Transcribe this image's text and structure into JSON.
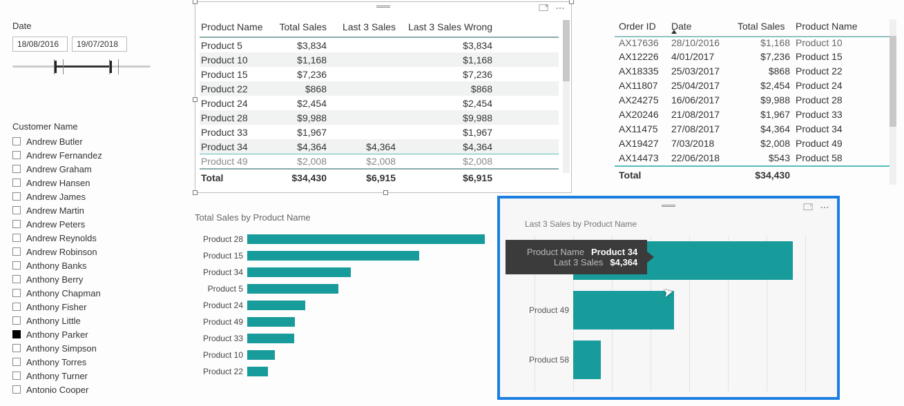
{
  "date_slicer": {
    "title": "Date",
    "start": "18/08/2016",
    "end": "19/07/2018"
  },
  "customer_slicer": {
    "title": "Customer Name",
    "items": [
      {
        "name": "Andrew Butler",
        "selected": false
      },
      {
        "name": "Andrew Fernandez",
        "selected": false
      },
      {
        "name": "Andrew Graham",
        "selected": false
      },
      {
        "name": "Andrew Hansen",
        "selected": false
      },
      {
        "name": "Andrew James",
        "selected": false
      },
      {
        "name": "Andrew Martin",
        "selected": false
      },
      {
        "name": "Andrew Peters",
        "selected": false
      },
      {
        "name": "Andrew Reynolds",
        "selected": false
      },
      {
        "name": "Andrew Robinson",
        "selected": false
      },
      {
        "name": "Anthony Banks",
        "selected": false
      },
      {
        "name": "Anthony Berry",
        "selected": false
      },
      {
        "name": "Anthony Chapman",
        "selected": false
      },
      {
        "name": "Anthony Fisher",
        "selected": false
      },
      {
        "name": "Anthony Little",
        "selected": false
      },
      {
        "name": "Anthony Parker",
        "selected": true
      },
      {
        "name": "Anthony Simpson",
        "selected": false
      },
      {
        "name": "Anthony Torres",
        "selected": false
      },
      {
        "name": "Anthony Turner",
        "selected": false
      },
      {
        "name": "Antonio Cooper",
        "selected": false
      }
    ]
  },
  "sales_table": {
    "headers": [
      "Product Name",
      "Total Sales",
      "Last 3 Sales",
      "Last 3 Sales Wrong"
    ],
    "rows": [
      {
        "product": "Product 5",
        "total": "$3,834",
        "last3": "",
        "last3wrong": "$3,834"
      },
      {
        "product": "Product 10",
        "total": "$1,168",
        "last3": "",
        "last3wrong": "$1,168"
      },
      {
        "product": "Product 15",
        "total": "$7,236",
        "last3": "",
        "last3wrong": "$7,236"
      },
      {
        "product": "Product 22",
        "total": "$868",
        "last3": "",
        "last3wrong": "$868"
      },
      {
        "product": "Product 24",
        "total": "$2,454",
        "last3": "",
        "last3wrong": "$2,454"
      },
      {
        "product": "Product 28",
        "total": "$9,988",
        "last3": "",
        "last3wrong": "$9,988"
      },
      {
        "product": "Product 33",
        "total": "$1,967",
        "last3": "",
        "last3wrong": "$1,967"
      },
      {
        "product": "Product 34",
        "total": "$4,364",
        "last3": "$4,364",
        "last3wrong": "$4,364"
      },
      {
        "product": "Product 49",
        "total": "$2,008",
        "last3": "$2,008",
        "last3wrong": "$2,008"
      }
    ],
    "total": {
      "label": "Total",
      "total": "$34,430",
      "last3": "$6,915",
      "last3wrong": "$6,915"
    }
  },
  "order_table": {
    "headers": [
      "Order ID",
      "Date",
      "Total Sales",
      "Product Name"
    ],
    "sort_column": "Date",
    "rows": [
      {
        "id": "AX17636",
        "date": "28/10/2016",
        "sales": "$1,168",
        "product": "Product 10"
      },
      {
        "id": "AX12226",
        "date": "4/01/2017",
        "sales": "$7,236",
        "product": "Product 15"
      },
      {
        "id": "AX18335",
        "date": "25/03/2017",
        "sales": "$868",
        "product": "Product 22"
      },
      {
        "id": "AX11807",
        "date": "25/04/2017",
        "sales": "$2,454",
        "product": "Product 24"
      },
      {
        "id": "AX24275",
        "date": "16/06/2017",
        "sales": "$9,988",
        "product": "Product 28"
      },
      {
        "id": "AX20246",
        "date": "21/08/2017",
        "sales": "$1,967",
        "product": "Product 33"
      },
      {
        "id": "AX11475",
        "date": "27/08/2017",
        "sales": "$4,364",
        "product": "Product 34"
      },
      {
        "id": "AX19427",
        "date": "7/03/2018",
        "sales": "$2,008",
        "product": "Product 49"
      },
      {
        "id": "AX14473",
        "date": "22/06/2018",
        "sales": "$543",
        "product": "Product 58"
      }
    ],
    "total": {
      "label": "Total",
      "sales": "$34,430"
    }
  },
  "chart_data": [
    {
      "type": "bar",
      "orientation": "horizontal",
      "title": "Total Sales by Product Name",
      "xlabel": "",
      "ylabel": "",
      "categories": [
        "Product 28",
        "Product 15",
        "Product 34",
        "Product 5",
        "Product 24",
        "Product 49",
        "Product 33",
        "Product 10",
        "Product 22"
      ],
      "values": [
        9988,
        7236,
        4364,
        3834,
        2454,
        2008,
        1967,
        1168,
        868
      ],
      "xlim": [
        0,
        10000
      ]
    },
    {
      "type": "bar",
      "orientation": "horizontal",
      "title": "Last 3 Sales by Product Name",
      "xlabel": "",
      "ylabel": "",
      "categories": [
        "Product 34",
        "Product 49",
        "Product 58"
      ],
      "values": [
        4364,
        2008,
        543
      ],
      "xlim": [
        0,
        5000
      ]
    }
  ],
  "tooltip": {
    "rowlabel1": "Product Name",
    "rowval1": "Product 34",
    "rowlabel2": "Last 3 Sales",
    "rowval2": "$4,364"
  }
}
